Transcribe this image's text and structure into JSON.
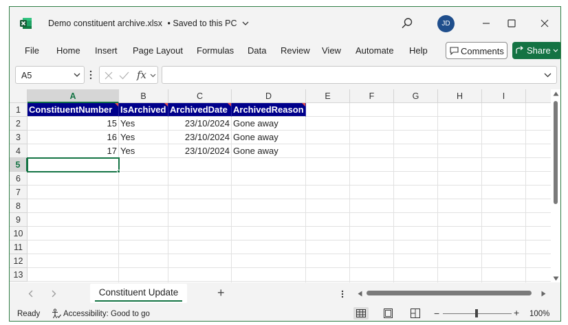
{
  "titlebar": {
    "app_icon": "excel-icon",
    "file_title": "Demo constituent archive.xlsx",
    "save_status": "•  Saved to this PC",
    "avatar_initials": "JD"
  },
  "menu": {
    "items": [
      "File",
      "Home",
      "Insert",
      "Page Layout",
      "Formulas",
      "Data",
      "Review",
      "View",
      "Automate",
      "Help"
    ],
    "comments_label": "Comments",
    "share_label": "Share"
  },
  "formula_bar": {
    "name_box": "A5",
    "fx_label": "fx",
    "formula": ""
  },
  "sheet": {
    "columns": [
      "A",
      "B",
      "C",
      "D",
      "E",
      "F",
      "G",
      "H",
      "I"
    ],
    "rows": [
      "1",
      "2",
      "3",
      "4",
      "5",
      "6",
      "7",
      "8",
      "9",
      "10",
      "11",
      "12",
      "13"
    ],
    "selected_cell": "A5",
    "header_row": [
      "ConstituentNumber",
      "IsArchived",
      "ArchivedDate",
      "ArchivedReason"
    ],
    "data_rows": [
      [
        "15",
        "Yes",
        "23/10/2024",
        "Gone away"
      ],
      [
        "16",
        "Yes",
        "23/10/2024",
        "Gone away"
      ],
      [
        "17",
        "Yes",
        "23/10/2024",
        "Gone away"
      ]
    ],
    "header_fill": "#00008b",
    "accent": "#137343"
  },
  "tabs": {
    "active_sheet": "Constituent Update",
    "add_label": "+"
  },
  "status": {
    "ready": "Ready",
    "accessibility": "Accessibility: Good to go",
    "zoom": "100%"
  }
}
